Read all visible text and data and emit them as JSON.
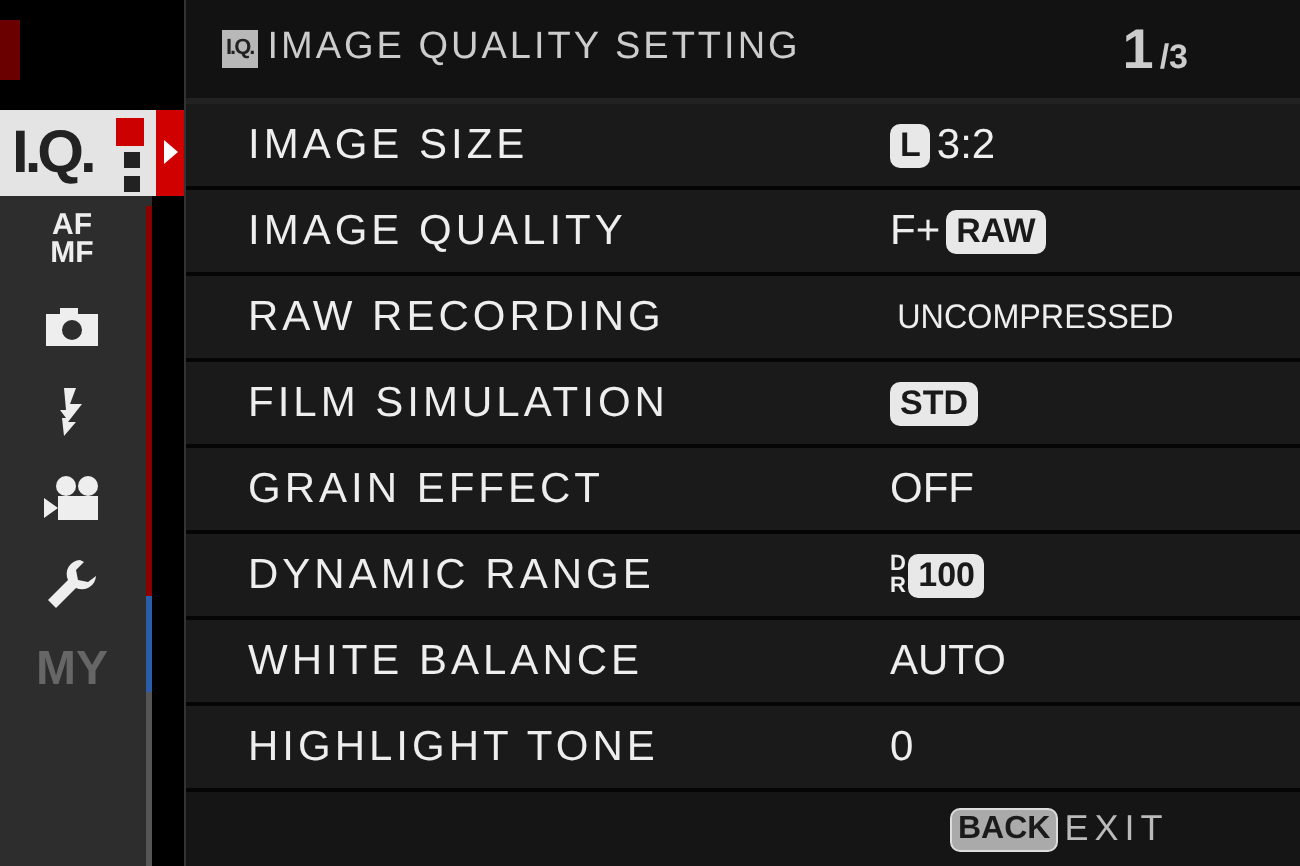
{
  "sidebar": {
    "items": [
      {
        "kind": "iq",
        "label": "I.Q.",
        "selected": true,
        "disabled": false
      },
      {
        "kind": "afmf",
        "label": "AF",
        "label2": "MF",
        "selected": false,
        "disabled": false
      },
      {
        "kind": "camera",
        "selected": false,
        "disabled": false
      },
      {
        "kind": "flash",
        "selected": false,
        "disabled": false
      },
      {
        "kind": "movie",
        "selected": false,
        "disabled": false
      },
      {
        "kind": "wrench",
        "selected": false,
        "disabled": false
      },
      {
        "kind": "text",
        "label": "MY",
        "selected": false,
        "disabled": true
      }
    ]
  },
  "header": {
    "icon_label": "I.Q.",
    "title": "IMAGE QUALITY SETTING",
    "page": "1",
    "page_total": "/3"
  },
  "settings": [
    {
      "label": "IMAGE SIZE",
      "value": [
        {
          "kind": "badge",
          "text": "L"
        },
        {
          "kind": "text",
          "text": "3:2"
        }
      ]
    },
    {
      "label": "IMAGE QUALITY",
      "value": [
        {
          "kind": "text",
          "text": "F+"
        },
        {
          "kind": "badge",
          "text": "RAW"
        }
      ]
    },
    {
      "label": "RAW RECORDING",
      "value": [
        {
          "kind": "narrow",
          "text": "UNCOMPRESSED"
        }
      ]
    },
    {
      "label": "FILM SIMULATION",
      "value": [
        {
          "kind": "badge",
          "text": "STD"
        }
      ]
    },
    {
      "label": "GRAIN EFFECT",
      "value": [
        {
          "kind": "text",
          "text": "OFF"
        }
      ]
    },
    {
      "label": "DYNAMIC RANGE",
      "value": [
        {
          "kind": "stacked",
          "text": "DR"
        },
        {
          "kind": "badge",
          "text": "100"
        }
      ]
    },
    {
      "label": "WHITE BALANCE",
      "value": [
        {
          "kind": "text",
          "text": "AUTO"
        }
      ]
    },
    {
      "label": "HIGHLIGHT TONE",
      "value": [
        {
          "kind": "text",
          "text": "0"
        }
      ]
    }
  ],
  "footer": {
    "key": "BACK",
    "action": "EXIT"
  }
}
